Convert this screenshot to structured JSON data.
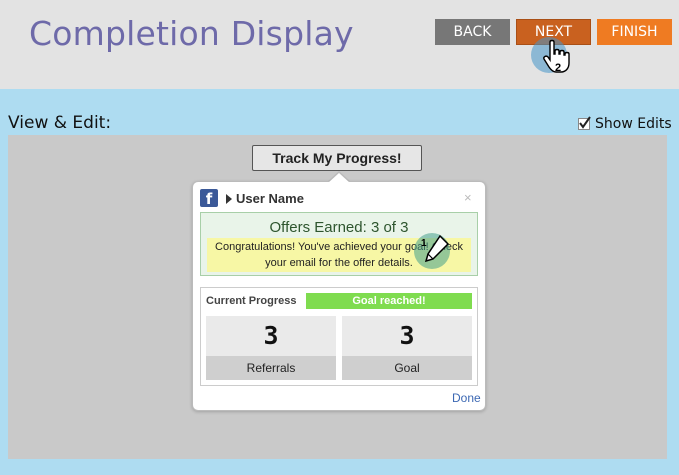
{
  "header": {
    "title": "Completion Display",
    "buttons": {
      "back": "BACK",
      "next": "NEXT",
      "finish": "FINISH"
    },
    "cursor_step": "2"
  },
  "workspace": {
    "view_label": "View & Edit:",
    "show_edits_label": "Show Edits",
    "show_edits_checked": true
  },
  "widget": {
    "track_button": "Track My Progress!",
    "popup": {
      "user_name": "User Name",
      "close": "×",
      "offers_title": "Offers Earned: 3 of 3",
      "congrats_line1": "Congratulations! You've achieved your goal! Check",
      "congrats_line2": "your email for the offer details.",
      "edit_step": "1",
      "current_progress_label": "Current Progress",
      "goal_status": "Goal reached!",
      "stats": [
        {
          "value": "3",
          "label": "Referrals"
        },
        {
          "value": "3",
          "label": "Goal"
        }
      ],
      "done": "Done"
    }
  },
  "colors": {
    "title": "#6e6aa9",
    "back": "#777777",
    "next": "#c9611f",
    "finish": "#ef7b22",
    "goal_bar": "#7fdc4f",
    "canvas_bg": "#c9c9c9",
    "page_bg": "#aedcf1"
  },
  "icons": [
    "facebook-icon",
    "caret-right-icon",
    "close-icon",
    "pencil-edit-icon",
    "hand-pointer-icon",
    "checkmark-icon"
  ]
}
